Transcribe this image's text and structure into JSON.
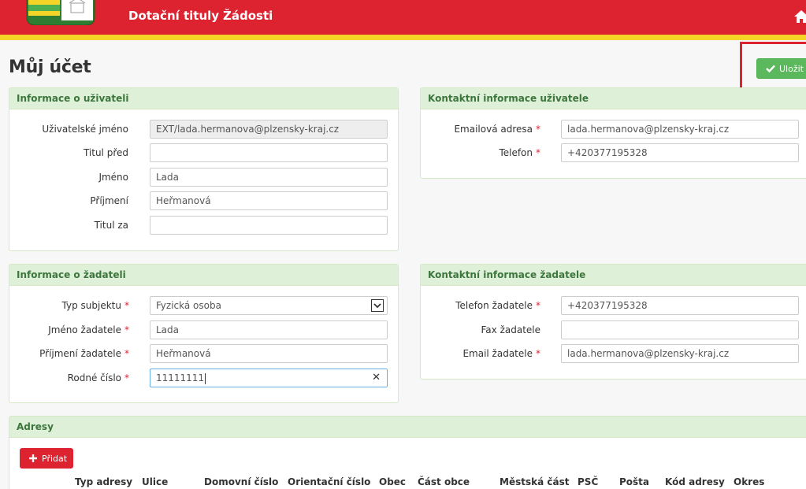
{
  "header": {
    "nav": [
      "Dotační tituly",
      "Žádosti"
    ],
    "colors": {
      "primary": "#dd2230",
      "stripe": "#f4d527"
    }
  },
  "page": {
    "title": "Můj účet",
    "save_label": "Uložit"
  },
  "user_info": {
    "title": "Informace o uživateli",
    "fields": [
      {
        "label": "Uživatelské jméno",
        "value": "EXT/lada.hermanova@plzensky-kraj.cz",
        "required": false,
        "readonly": true
      },
      {
        "label": "Titul před",
        "value": "",
        "required": false
      },
      {
        "label": "Jméno",
        "value": "Lada",
        "required": false
      },
      {
        "label": "Příjmení",
        "value": "Heřmanová",
        "required": false
      },
      {
        "label": "Titul za",
        "value": "",
        "required": false
      }
    ]
  },
  "user_contact": {
    "title": "Kontaktní informace uživatele",
    "fields": [
      {
        "label": "Emailová adresa",
        "value": "lada.hermanova@plzensky-kraj.cz",
        "required": true
      },
      {
        "label": "Telefon",
        "value": "+420377195328",
        "required": true
      }
    ]
  },
  "applicant_info": {
    "title": "Informace o žadateli",
    "fields": [
      {
        "label": "Typ subjektu",
        "value": "Fyzická osoba",
        "required": true,
        "type": "select"
      },
      {
        "label": "Jméno žadatele",
        "value": "Lada",
        "required": true
      },
      {
        "label": "Příjmení žadatele",
        "value": "Heřmanová",
        "required": true
      },
      {
        "label": "Rodné číslo",
        "value": "11111111",
        "required": true,
        "focused": true
      }
    ]
  },
  "applicant_contact": {
    "title": "Kontaktní informace žadatele",
    "fields": [
      {
        "label": "Telefon žadatele",
        "value": "+420377195328",
        "required": true
      },
      {
        "label": "Fax žadatele",
        "value": "",
        "required": false
      },
      {
        "label": "Email žadatele",
        "value": "lada.hermanova@plzensky-kraj.cz",
        "required": true
      }
    ]
  },
  "addresses": {
    "title": "Adresy",
    "add_label": "Přidat",
    "columns": [
      "Typ adresy",
      "Ulice",
      "Domovní číslo",
      "Orientační číslo",
      "Obec",
      "Část obce",
      "Městská část",
      "PSČ",
      "Pošta",
      "Kód adresy",
      "Okres"
    ]
  }
}
